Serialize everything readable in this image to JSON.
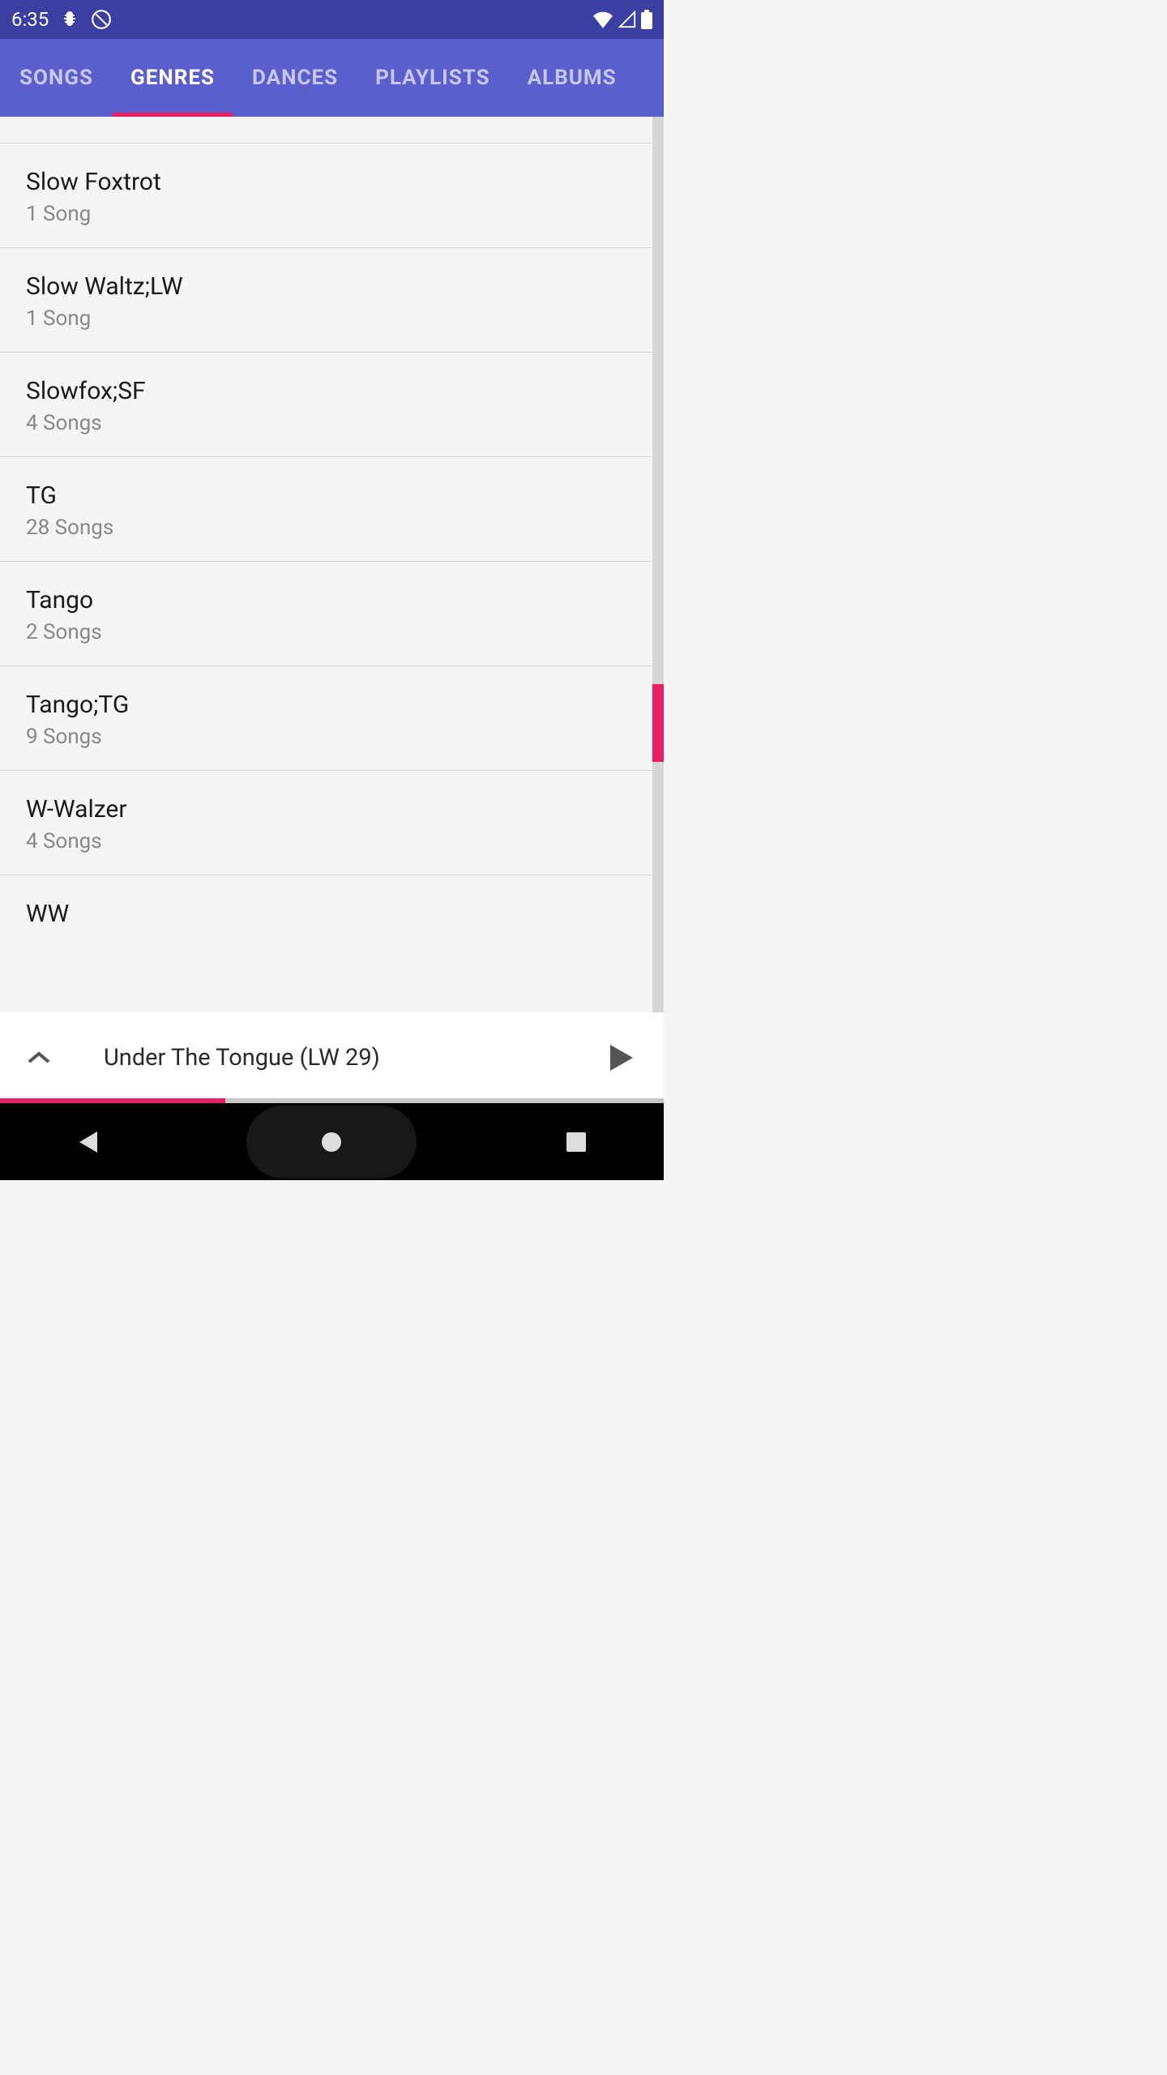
{
  "status": {
    "time": "6:35"
  },
  "tabs": {
    "songs": "SONGS",
    "genres": "GENRES",
    "dances": "DANCES",
    "playlists": "PLAYLISTS",
    "albums": "ALBUMS"
  },
  "genres": [
    {
      "title": "Slow Foxtrot",
      "count": "1 Song"
    },
    {
      "title": "Slow Waltz;LW",
      "count": "1 Song"
    },
    {
      "title": "Slowfox;SF",
      "count": "4 Songs"
    },
    {
      "title": "TG",
      "count": "28 Songs"
    },
    {
      "title": "Tango",
      "count": "2 Songs"
    },
    {
      "title": "Tango;TG",
      "count": "9 Songs"
    },
    {
      "title": "W-Walzer",
      "count": "4 Songs"
    },
    {
      "title": "WW",
      "count": ""
    }
  ],
  "now_playing": {
    "title": "Under The Tongue (LW 29)"
  }
}
